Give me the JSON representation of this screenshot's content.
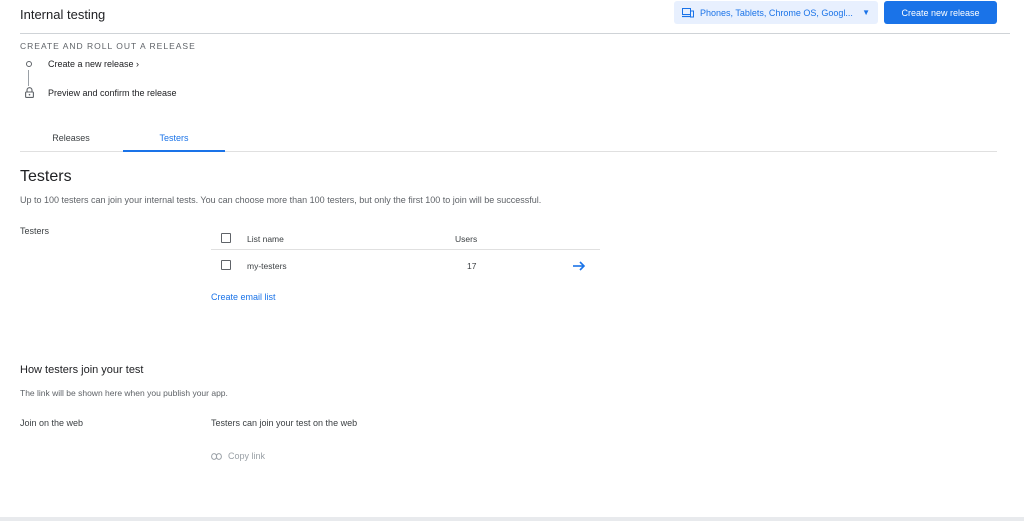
{
  "header": {
    "title": "Internal testing",
    "device_select": "Phones, Tablets, Chrome OS, Googl...",
    "create_release_button": "Create new release"
  },
  "release": {
    "section_label": "CREATE AND ROLL OUT A RELEASE",
    "steps": [
      {
        "label": "Create a new release ›",
        "icon": "dot-icon"
      },
      {
        "label": "Preview and confirm the release",
        "icon": "lock-icon"
      }
    ]
  },
  "tabs": [
    {
      "label": "Releases",
      "active": false
    },
    {
      "label": "Testers",
      "active": true
    }
  ],
  "testers": {
    "heading": "Testers",
    "description": "Up to 100 testers can join your internal tests. You can choose more than 100 testers, but only the first 100 to join will be successful.",
    "row_label": "Testers",
    "table": {
      "columns": [
        "List name",
        "Users"
      ],
      "rows": [
        {
          "name": "my-testers",
          "users": "17"
        }
      ]
    },
    "create_list_link": "Create email list"
  },
  "join": {
    "heading": "How testers join your test",
    "description": "The link will be shown here when you publish your app.",
    "row_label": "Join on the web",
    "text": "Testers can join your test on the web",
    "copy_link": "Copy link"
  },
  "colors": {
    "accent": "#1a73e8",
    "accent_light": "#e8f0fe",
    "muted": "#9aa0a6"
  }
}
